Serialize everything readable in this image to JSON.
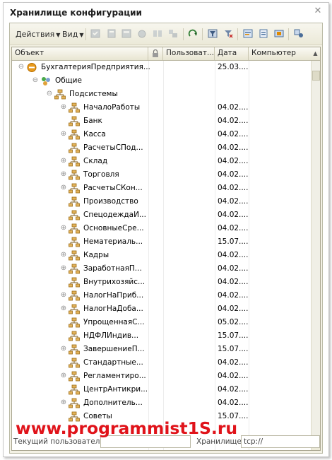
{
  "window": {
    "title": "Хранилище конфигурации"
  },
  "toolbar": {
    "actions_label": "Действия",
    "view_label": "Вид"
  },
  "columns": [
    "Объект",
    "",
    "Пользоват...",
    "Дата",
    "Компьютер"
  ],
  "tree": [
    {
      "label": "БухгалтерияПредприятия...",
      "date": "25.03....",
      "expander": "−",
      "icon": "root-config-icon"
    },
    {
      "label": "Общие",
      "date": "",
      "expander": "−",
      "icon": "common-objects-icon"
    },
    {
      "label": "Подсистемы",
      "date": "",
      "expander": "−",
      "icon": "subsystem-icon"
    },
    {
      "label": "НачалоРаботы",
      "date": "04.02....",
      "expander": "+",
      "icon": "subsystem-icon"
    },
    {
      "label": "Банк",
      "date": "04.02....",
      "expander": "",
      "icon": "subsystem-icon"
    },
    {
      "label": "Касса",
      "date": "04.02....",
      "expander": "+",
      "icon": "subsystem-icon"
    },
    {
      "label": "РасчетыСПод...",
      "date": "04.02....",
      "expander": "",
      "icon": "subsystem-icon"
    },
    {
      "label": "Склад",
      "date": "04.02....",
      "expander": "+",
      "icon": "subsystem-icon"
    },
    {
      "label": "Торговля",
      "date": "04.02....",
      "expander": "+",
      "icon": "subsystem-icon"
    },
    {
      "label": "РасчетыСКон...",
      "date": "04.02....",
      "expander": "+",
      "icon": "subsystem-icon"
    },
    {
      "label": "Производство",
      "date": "04.02....",
      "expander": "",
      "icon": "subsystem-icon"
    },
    {
      "label": "СпецодеждаИ...",
      "date": "04.02....",
      "expander": "",
      "icon": "subsystem-icon"
    },
    {
      "label": "ОсновныеСре...",
      "date": "04.02....",
      "expander": "+",
      "icon": "subsystem-icon"
    },
    {
      "label": "Нематериаль...",
      "date": "15.07....",
      "expander": "",
      "icon": "subsystem-icon"
    },
    {
      "label": "Кадры",
      "date": "04.02....",
      "expander": "+",
      "icon": "subsystem-icon"
    },
    {
      "label": "ЗаработнаяП...",
      "date": "04.02....",
      "expander": "+",
      "icon": "subsystem-icon"
    },
    {
      "label": "Внутрихозяйс...",
      "date": "04.02....",
      "expander": "",
      "icon": "subsystem-icon"
    },
    {
      "label": "НалогНаПриб...",
      "date": "04.02....",
      "expander": "+",
      "icon": "subsystem-icon"
    },
    {
      "label": "НалогНаДоба...",
      "date": "04.02....",
      "expander": "+",
      "icon": "subsystem-icon"
    },
    {
      "label": "УпрощеннаяС...",
      "date": "05.02....",
      "expander": "",
      "icon": "subsystem-icon"
    },
    {
      "label": "НДФЛИндив...",
      "date": "15.07....",
      "expander": "",
      "icon": "subsystem-icon"
    },
    {
      "label": "ЗавершениеП...",
      "date": "15.07....",
      "expander": "+",
      "icon": "subsystem-icon"
    },
    {
      "label": "Стандартные...",
      "date": "04.02....",
      "expander": "",
      "icon": "subsystem-icon"
    },
    {
      "label": "Регламентиро...",
      "date": "04.02....",
      "expander": "+",
      "icon": "subsystem-icon"
    },
    {
      "label": "ЦентрАнтикри...",
      "date": "04.02....",
      "expander": "",
      "icon": "subsystem-icon"
    },
    {
      "label": "Дополнитель...",
      "date": "04.02....",
      "expander": "+",
      "icon": "subsystem-icon"
    },
    {
      "label": "Советы",
      "date": "15.07....",
      "expander": "",
      "icon": "subsystem-icon"
    }
  ],
  "status": {
    "current_user_label": "Текущий пользователь:",
    "current_user_value": "",
    "storage_label": "Хранилище:",
    "storage_value": "tcp://"
  },
  "watermark": {
    "text": "www.programmist1S.ru"
  },
  "colors": {
    "accent_orange": "#e89a1c",
    "watermark_red": "#e0131a",
    "panel_bg": "#f3f1e4"
  }
}
